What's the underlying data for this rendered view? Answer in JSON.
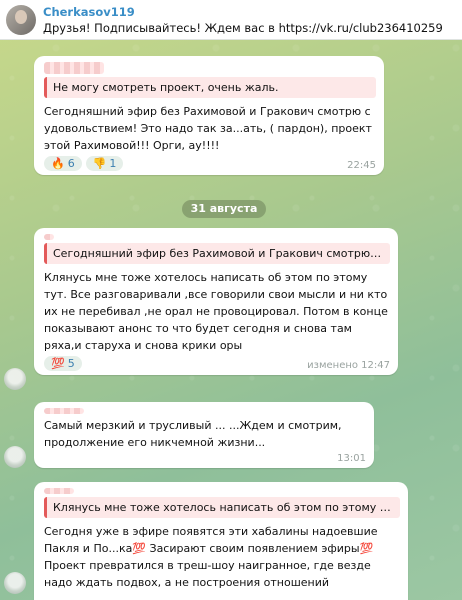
{
  "pinned": {
    "name": "Cherkasov119",
    "text": "Друзья! Подписывайтесь! Ждем вас в https://vk.ru/club236410259"
  },
  "messages": [
    {
      "quote": "Не могу смотреть проект, очень жаль.",
      "text": "Сегодняшний эфир без Рахимовой и Гракович смотрю с удовольствием! Это надо так за...ать, ( пардон), проект этой Рахимовой!!! Орги, ау!!!!",
      "reactions": [
        {
          "emoji": "🔥",
          "count": "6"
        },
        {
          "emoji": "👎",
          "count": "1"
        }
      ],
      "time": "22:45"
    },
    {
      "quote": "Сегодняшний эфир без Рахимовой и Гракович смотрю с у...",
      "text": "Клянусь мне тоже хотелось написать об этом по этому тут. Все разговаривали ,все говорили свои мысли и ни кто их не перебивал ,не орал не провоцировал. Потом в конце показывают анонс то что будет сегодня и снова там ряха,и старуха и снова крики оры",
      "reactions": [
        {
          "emoji": "💯",
          "count": "5"
        }
      ],
      "time": "изменено 12:47"
    },
    {
      "text": "Самый мерзкий и трусливый ... ...Ждем и смотрим, продолжение его никчемной жизни...",
      "time": "13:01"
    },
    {
      "quote": "Клянусь мне тоже хотелось написать об этом по этому тут. В...",
      "text": "Сегодня уже в эфире появятся эти хабалины надоевшие Пакля и По...ка💯 Засирают своим появлением эфиры💯 Проект превратился в треш-шоу наигранное, где везде надо ждать подвох, а не построения отношений"
    }
  ],
  "date": "31 августа"
}
